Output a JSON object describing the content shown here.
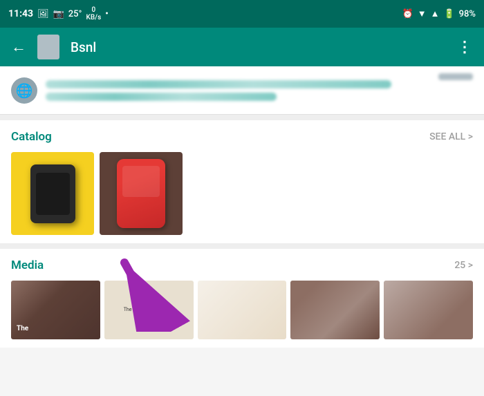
{
  "status_bar": {
    "time": "11:43",
    "temperature": "25°",
    "network_speed": "0\nKB/s",
    "battery": "98%",
    "signal_icons": "⏰ ▼ ▲"
  },
  "app_bar": {
    "back_label": "←",
    "title": "Bsnl",
    "more_icon": "⋮"
  },
  "catalog": {
    "title": "Catalog",
    "see_all": "SEE ALL >",
    "items": [
      {
        "alt": "Dark phone on yellow background"
      },
      {
        "alt": "Red phone on dark background"
      }
    ]
  },
  "media": {
    "title": "Media",
    "count": "25 >",
    "items": [
      {
        "alt": "Book cover 1"
      },
      {
        "alt": "The Relativity book"
      },
      {
        "alt": "Book page"
      },
      {
        "alt": "Open book"
      },
      {
        "alt": "Book pages"
      }
    ]
  },
  "arrow": {
    "description": "Purple arrow pointing up-right"
  }
}
